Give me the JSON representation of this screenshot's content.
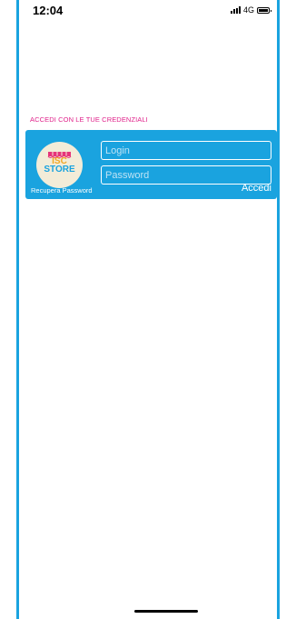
{
  "status_bar": {
    "time": "12:04",
    "network": "4G",
    "signal_icon": "signal-bars-icon",
    "battery_icon": "battery-icon"
  },
  "login": {
    "section_title": "ACCEDI CON LE TUE CREDENZIALI",
    "logo": {
      "text_top": "ISC",
      "text_bottom": "STORE",
      "icon": "store-awning-icon"
    },
    "login_placeholder": "Login",
    "password_placeholder": "Password",
    "recover_label": "Recupera Password",
    "submit_label": "Accedi"
  },
  "colors": {
    "accent": "#1aa3df",
    "section_title": "#e0218a"
  }
}
